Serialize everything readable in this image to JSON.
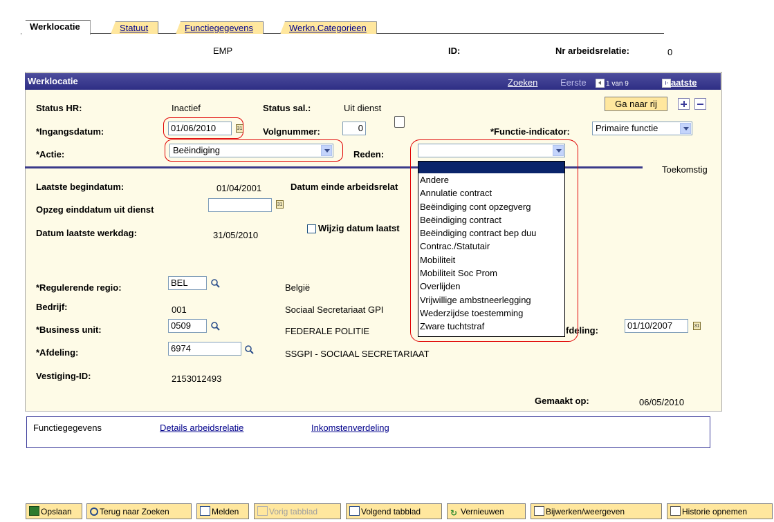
{
  "tabs": [
    "Werklocatie",
    "Statuut",
    "Functiegegevens",
    "Werkn.Categorieen"
  ],
  "header": {
    "emp": "EMP",
    "id_label": "ID:",
    "nr_label": "Nr arbeidsrelatie:",
    "nr_value": "0"
  },
  "panel": {
    "title": "Werklocatie",
    "search_link": "Zoeken",
    "first": "Eerste",
    "range": "1 van 9",
    "last": "Laatste",
    "goto_row": "Ga naar rij"
  },
  "fields": {
    "status_hr_label": "Status HR:",
    "status_hr_value": "Inactief",
    "status_sal_label": "Status sal.:",
    "status_sal_value": "Uit dienst",
    "ingangsdatum_label": "*Ingangsdatum:",
    "ingangsdatum_value": "01/06/2010",
    "volgnummer_label": "Volgnummer:",
    "volgnummer_value": "0",
    "functie_indicator_label": "*Functie-indicator:",
    "functie_indicator_value": "Primaire functie",
    "actie_label": "*Actie:",
    "actie_value": "Beëindiging",
    "reden_label": "Reden:",
    "reden_value": "",
    "toekomstig": "Toekomstig",
    "laatste_begindatum_label": "Laatste begindatum:",
    "laatste_begindatum_value": "01/04/2001",
    "datum_einde_label": "Datum einde arbeidsrelat",
    "opzeg_label": "Opzeg einddatum uit dienst",
    "datum_laatste_werkdag_label": "Datum laatste werkdag:",
    "datum_laatste_werkdag_value": "31/05/2010",
    "wijzig_label": "Wijzig datum laatst",
    "regio_label": "*Regulerende regio:",
    "regio_value": "BEL",
    "regio_desc": "België",
    "bedrijf_label": "Bedrijf:",
    "bedrijf_value": "001",
    "bedrijf_desc": "Sociaal Secretariaat GPI",
    "bu_label": "*Business unit:",
    "bu_value": "0509",
    "bu_desc": "FEDERALE POLITIE",
    "afdeling_date_label": "fdeling:",
    "afdeling_date_value": "01/10/2007",
    "afdeling_label": "*Afdeling:",
    "afdeling_value": "6974",
    "afdeling_desc": "SSGPI - SOCIAAL SECRETARIAAT",
    "vestiging_label": "Vestiging-ID:",
    "vestiging_value": "2153012493",
    "gemaakt_label": "Gemaakt op:",
    "gemaakt_value": "06/05/2010"
  },
  "reden_options": [
    "",
    "Andere",
    "Annulatie contract",
    "Beëindiging cont opzegverg",
    "Beëindiging contract",
    "Beëindiging contract bep duu",
    "Contrac./Statutair",
    "Mobiliteit",
    "Mobiliteit Soc Prom",
    "Overlijden",
    "Vrijwillige ambstneerlegging",
    "Wederzijdse toestemming",
    "Zware tuchtstraf"
  ],
  "links": {
    "functiegegevens": "Functiegegevens",
    "details": "Details arbeidsrelatie",
    "inkomsten": "Inkomstenverdeling"
  },
  "toolbar": {
    "save": "Opslaan",
    "back": "Terug naar Zoeken",
    "notify": "Melden",
    "prev": "Vorig tabblad",
    "next": "Volgend tabblad",
    "refresh": "Vernieuwen",
    "update": "Bijwerken/weergeven",
    "history": "Historie opnemen"
  },
  "colors": {
    "tab_bg": "#ffe79e",
    "panel_header": "#2e2e85",
    "panel_bg": "#fefbe7",
    "highlight_oval": "#e00000",
    "link": "#00008b"
  }
}
